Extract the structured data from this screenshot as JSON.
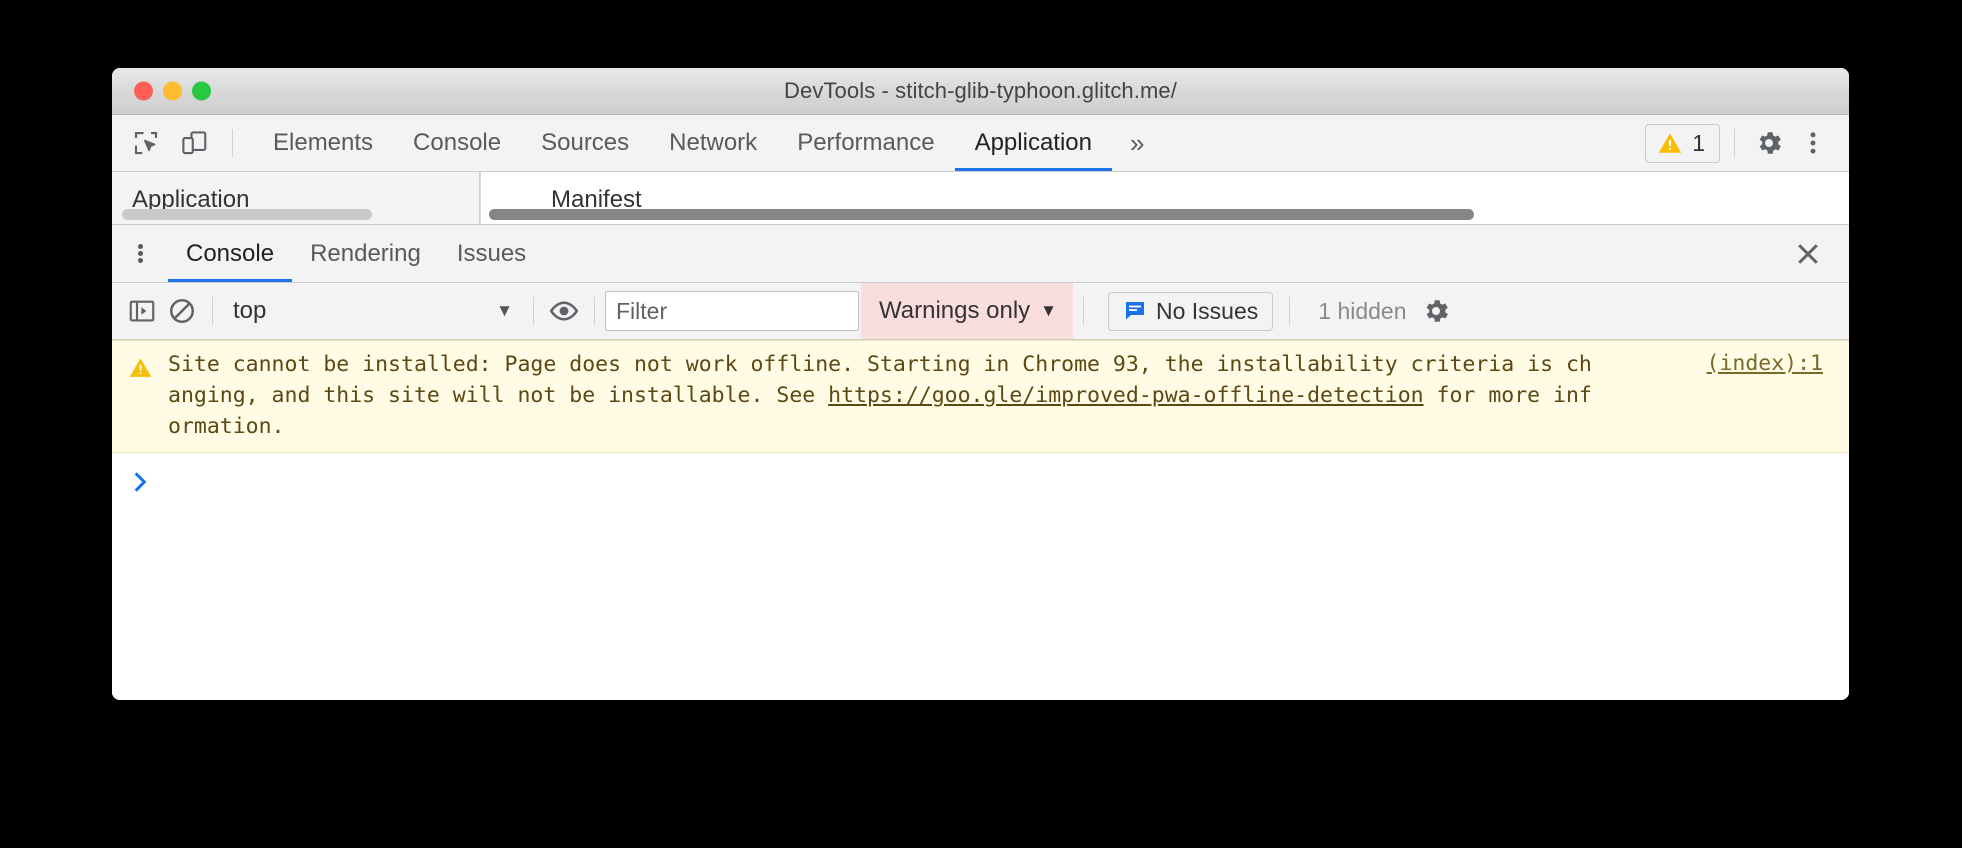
{
  "window": {
    "title": "DevTools - stitch-glib-typhoon.glitch.me/",
    "traffic_lights": {
      "close": "close-window",
      "minimize": "minimize-window",
      "zoom": "zoom-window"
    }
  },
  "toolbar": {
    "inspect_icon": "inspect-element-icon",
    "device_icon": "device-toolbar-icon",
    "panels": [
      {
        "label": "Elements",
        "active": false
      },
      {
        "label": "Console",
        "active": false
      },
      {
        "label": "Sources",
        "active": false
      },
      {
        "label": "Network",
        "active": false
      },
      {
        "label": "Performance",
        "active": false
      },
      {
        "label": "Application",
        "active": true
      }
    ],
    "more_tabs": "»",
    "warning_badge": {
      "icon": "warning-triangle-icon",
      "count": "1"
    },
    "settings_icon": "gear-icon",
    "menu_icon": "three-dot-menu-icon"
  },
  "panel_peek": {
    "sidebar_title": "Application",
    "main_title": "Manifest"
  },
  "drawer": {
    "menu_icon": "drawer-kebab-icon",
    "tabs": [
      {
        "label": "Console",
        "active": true
      },
      {
        "label": "Rendering",
        "active": false
      },
      {
        "label": "Issues",
        "active": false
      }
    ],
    "close_icon": "close-icon"
  },
  "console_toolbar": {
    "sidebar_toggle_icon": "console-sidebar-toggle-icon",
    "clear_icon": "clear-console-icon",
    "context": {
      "value": "top",
      "caret": "▼"
    },
    "eye_icon": "live-expression-eye-icon",
    "filter": {
      "placeholder": "Filter",
      "value": ""
    },
    "level": {
      "value": "Warnings only",
      "caret": "▼",
      "background": "#fadddd"
    },
    "issues": {
      "label": "No Issues",
      "icon": "issues-speech-bubble-icon",
      "icon_color": "#1a73e8"
    },
    "hidden_count": "1 hidden",
    "settings_icon": "console-settings-gear-icon"
  },
  "console": {
    "messages": [
      {
        "level": "warning",
        "icon": "warning-triangle-icon",
        "text_before_link": "Site cannot be installed: Page does not work offline. Starting in Chrome 93, the installability criteria is changing, and this site will not be installable. See ",
        "link_text": "https://goo.gle/improved-pwa-offline-detection",
        "text_after_link": " for more information.",
        "source": "(index):1",
        "background": "#fffbe5",
        "color": "#5c4813"
      }
    ],
    "prompt": {
      "chevron": "❯",
      "color": "#1a73e8",
      "value": ""
    }
  },
  "colors": {
    "accent": "#1a73e8",
    "warning_bg": "#fffbe5",
    "warning_text": "#5c4813",
    "error_filter_bg": "#fadddd",
    "chrome_bg": "#f3f3f3"
  }
}
